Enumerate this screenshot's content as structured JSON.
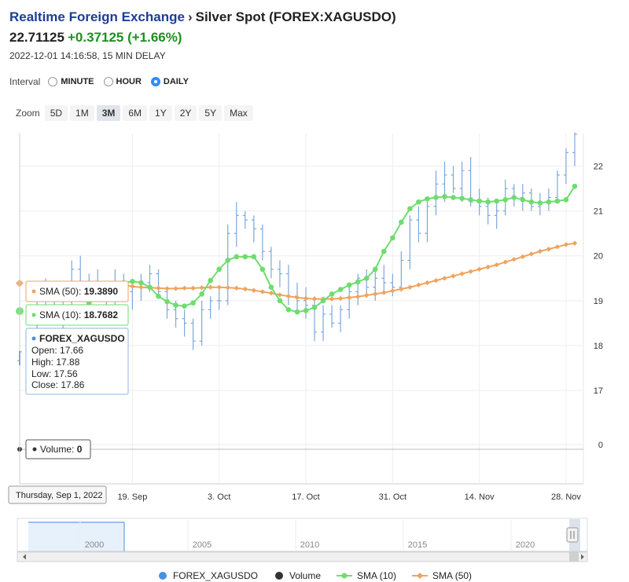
{
  "header": {
    "breadcrumb_link": "Realtime Foreign Exchange",
    "breadcrumb_sep": "›",
    "instrument": "Silver Spot (FOREX:XAGUSDO)",
    "price": "22.71125",
    "change": "+0.37125 (+1.66%)",
    "timestamp": "2022-12-01 14:16:58, 15 MIN DELAY"
  },
  "interval": {
    "label": "Interval",
    "options": [
      "MINUTE",
      "HOUR",
      "DAILY"
    ],
    "selected": "DAILY"
  },
  "zoom": {
    "label": "Zoom",
    "options": [
      "5D",
      "1M",
      "3M",
      "6M",
      "1Y",
      "2Y",
      "5Y",
      "Max"
    ],
    "selected": "3M"
  },
  "colors": {
    "bars": "#7fa6d9",
    "sma10": "#6fdc6f",
    "sma50": "#f0a35e",
    "forex": "#4a90e2",
    "volume": "#333333"
  },
  "tooltip": {
    "sma50_label": "SMA (50): ",
    "sma50_value": "19.3890",
    "sma10_label": "SMA (10): ",
    "sma10_value": "18.7682",
    "ohlc_title": "FOREX_XAGUSDO",
    "open": "Open: 17.66",
    "high": "High: 17.88",
    "low": "Low: 17.56",
    "close": "Close: 17.86",
    "volume_label": "Volume: ",
    "volume_value": "0",
    "date": "Thursday, Sep 1, 2022"
  },
  "navigator": {
    "labels": [
      "2000",
      "2005",
      "2010",
      "2015",
      "2020"
    ]
  },
  "legend": [
    {
      "name": "FOREX_XAGUSDO",
      "color": "#4a90e2",
      "marker": "dot"
    },
    {
      "name": "Volume",
      "color": "#333333",
      "marker": "dot"
    },
    {
      "name": "SMA (10)",
      "color": "#6fdc6f",
      "marker": "line-dot"
    },
    {
      "name": "SMA (50)",
      "color": "#f0a35e",
      "marker": "line-diamond"
    }
  ],
  "chart_data": {
    "type": "line",
    "x_tick_labels": [
      "19. Sep",
      "3. Oct",
      "17. Oct",
      "31. Oct",
      "14. Nov",
      "28. Nov"
    ],
    "y_tick_labels": [
      "22",
      "21",
      "20",
      "19",
      "18",
      "17",
      "0"
    ],
    "ylim": [
      16.6,
      22.9
    ],
    "x_range": [
      0,
      65
    ],
    "x_tick_positions": [
      13,
      23,
      33,
      43,
      53,
      63
    ],
    "ohlc": [
      [
        17.66,
        17.88,
        17.56,
        17.86
      ],
      [
        17.9,
        18.3,
        17.7,
        18.2
      ],
      [
        18.2,
        19.3,
        18.0,
        19.1
      ],
      [
        19.1,
        19.5,
        18.6,
        18.8
      ],
      [
        18.8,
        19.0,
        18.5,
        18.6
      ],
      [
        18.6,
        19.1,
        18.3,
        19.0
      ],
      [
        19.0,
        19.9,
        18.8,
        19.7
      ],
      [
        19.7,
        20.0,
        19.3,
        19.4
      ],
      [
        19.4,
        19.6,
        19.1,
        19.3
      ],
      [
        19.3,
        19.7,
        19.0,
        19.2
      ],
      [
        19.2,
        19.4,
        18.9,
        19.0
      ],
      [
        19.0,
        19.7,
        18.8,
        19.4
      ],
      [
        19.4,
        19.6,
        19.1,
        19.2
      ],
      [
        19.2,
        19.4,
        18.8,
        19.3
      ],
      [
        19.3,
        19.6,
        19.0,
        19.4
      ],
      [
        19.4,
        19.8,
        19.2,
        19.6
      ],
      [
        19.6,
        19.7,
        19.1,
        19.2
      ],
      [
        19.2,
        19.3,
        18.6,
        18.8
      ],
      [
        18.8,
        19.0,
        18.4,
        18.6
      ],
      [
        18.6,
        18.8,
        18.2,
        18.5
      ],
      [
        18.5,
        18.6,
        17.9,
        18.1
      ],
      [
        18.1,
        19.0,
        18.0,
        18.8
      ],
      [
        18.8,
        19.1,
        18.6,
        19.0
      ],
      [
        19.0,
        19.3,
        18.8,
        19.0
      ],
      [
        19.0,
        20.7,
        18.9,
        20.5
      ],
      [
        20.5,
        21.2,
        20.2,
        20.9
      ],
      [
        20.9,
        21.0,
        20.6,
        20.8
      ],
      [
        20.8,
        20.9,
        20.3,
        20.6
      ],
      [
        20.6,
        20.7,
        19.9,
        20.1
      ],
      [
        20.1,
        20.2,
        19.5,
        19.7
      ],
      [
        19.7,
        19.9,
        19.3,
        19.6
      ],
      [
        19.6,
        19.8,
        18.9,
        19.1
      ],
      [
        19.1,
        19.4,
        18.7,
        19.0
      ],
      [
        19.0,
        19.3,
        18.6,
        18.9
      ],
      [
        18.9,
        19.1,
        18.1,
        18.3
      ],
      [
        18.3,
        18.9,
        18.1,
        18.7
      ],
      [
        18.7,
        18.9,
        18.4,
        18.5
      ],
      [
        18.5,
        18.9,
        18.3,
        18.8
      ],
      [
        18.8,
        19.3,
        18.6,
        19.2
      ],
      [
        19.2,
        19.6,
        18.9,
        19.5
      ],
      [
        19.5,
        19.7,
        19.1,
        19.3
      ],
      [
        19.3,
        19.7,
        19.0,
        19.5
      ],
      [
        19.5,
        19.8,
        19.2,
        19.4
      ],
      [
        19.4,
        19.6,
        19.1,
        19.3
      ],
      [
        19.3,
        20.1,
        19.2,
        19.9
      ],
      [
        19.9,
        20.9,
        19.7,
        20.8
      ],
      [
        20.8,
        21.1,
        20.3,
        20.5
      ],
      [
        20.5,
        21.3,
        20.3,
        21.1
      ],
      [
        21.1,
        21.9,
        20.9,
        21.6
      ],
      [
        21.6,
        22.1,
        21.2,
        21.8
      ],
      [
        21.8,
        22.0,
        21.4,
        21.5
      ],
      [
        21.5,
        22.1,
        21.2,
        21.9
      ],
      [
        21.9,
        22.2,
        21.1,
        21.2
      ],
      [
        21.2,
        21.5,
        20.9,
        21.1
      ],
      [
        21.1,
        21.3,
        20.7,
        20.9
      ],
      [
        20.9,
        21.2,
        20.6,
        21.0
      ],
      [
        21.0,
        21.7,
        20.9,
        21.5
      ],
      [
        21.5,
        21.6,
        21.1,
        21.3
      ],
      [
        21.3,
        21.6,
        21.0,
        21.4
      ],
      [
        21.4,
        21.5,
        21.0,
        21.1
      ],
      [
        21.1,
        21.4,
        20.9,
        21.2
      ],
      [
        21.2,
        21.5,
        21.0,
        21.3
      ],
      [
        21.3,
        21.9,
        21.2,
        21.8
      ],
      [
        21.8,
        22.4,
        21.6,
        22.3
      ],
      [
        22.3,
        22.75,
        22.0,
        22.71
      ]
    ],
    "sma10": [
      18.77,
      18.95,
      19.12,
      19.25,
      19.3,
      19.4,
      19.43,
      19.4,
      19.3,
      19.1,
      18.98,
      18.9,
      18.88,
      18.95,
      19.15,
      19.45,
      19.7,
      19.9,
      19.98,
      19.98,
      19.98,
      19.7,
      19.3,
      19.0,
      18.8,
      18.75,
      18.78,
      18.85,
      19.0,
      19.15,
      19.25,
      19.35,
      19.42,
      19.5,
      19.7,
      20.1,
      20.4,
      20.75,
      21.05,
      21.2,
      21.27,
      21.3,
      21.32,
      21.3,
      21.28,
      21.25,
      21.22,
      21.2,
      21.22,
      21.25,
      21.3,
      21.25,
      21.2,
      21.18,
      21.2,
      21.22,
      21.25,
      21.55
    ],
    "sma10_start": 7,
    "sma50": [
      19.39,
      19.36,
      19.34,
      19.32,
      19.3,
      19.29,
      19.28,
      19.27,
      19.27,
      19.28,
      19.28,
      19.29,
      19.3,
      19.3,
      19.29,
      19.28,
      19.26,
      19.23,
      19.2,
      19.17,
      19.13,
      19.1,
      19.07,
      19.05,
      19.04,
      19.04,
      19.04,
      19.05,
      19.07,
      19.09,
      19.12,
      19.15,
      19.18,
      19.22,
      19.26,
      19.3,
      19.35,
      19.4,
      19.45,
      19.5,
      19.55,
      19.6,
      19.65,
      19.7,
      19.75,
      19.8,
      19.86,
      19.92,
      19.98,
      20.04,
      20.1,
      20.15,
      20.2,
      20.25,
      20.28
    ],
    "sma50_start": 10,
    "volume": 0
  }
}
